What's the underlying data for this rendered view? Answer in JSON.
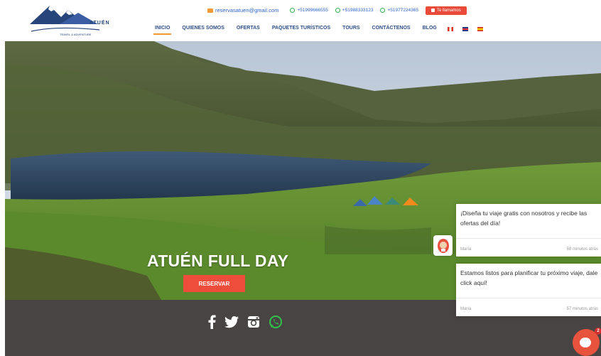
{
  "brand": {
    "logo_text": "ATUÉN",
    "logo_subtext": "TRAVEL & ADVENTURE"
  },
  "contact": {
    "email": "reservasatuen@gmail.com",
    "phones": [
      "+51999666555",
      "+51988333123",
      "+51977224365"
    ],
    "call_label": "Te llamamos"
  },
  "nav": {
    "items": [
      "INICIO",
      "QUIENES SOMOS",
      "OFERTAS",
      "PAQUETES TURÍSTICOS",
      "TOURS",
      "CONTÁCTENOS",
      "BLOG"
    ],
    "active_index": 0,
    "languages": [
      "Español (Perú)",
      "English",
      "Español"
    ]
  },
  "hero": {
    "title": "ATUÉN FULL DAY",
    "button_label": "RESERVAR"
  },
  "footer": {
    "social": [
      "facebook-icon",
      "twitter-icon",
      "instagram-icon",
      "whatsapp-icon"
    ]
  },
  "chat": {
    "messages": [
      {
        "text": "¡Diseña tu viaje gratis con nosotros y recibe las ofertas del día!",
        "author": "María",
        "time": "58 minutos atrás"
      },
      {
        "text": "Estamos listos para planificar tu próximo viaje, dale click aquí!",
        "author": "María",
        "time": "57 minutos atrás"
      }
    ],
    "unread_count": "2"
  },
  "colors": {
    "primary_blue": "#2f4f89",
    "accent_orange": "#f19b2c",
    "cta_red": "#ef4d3b",
    "footer_bg": "#474443"
  }
}
